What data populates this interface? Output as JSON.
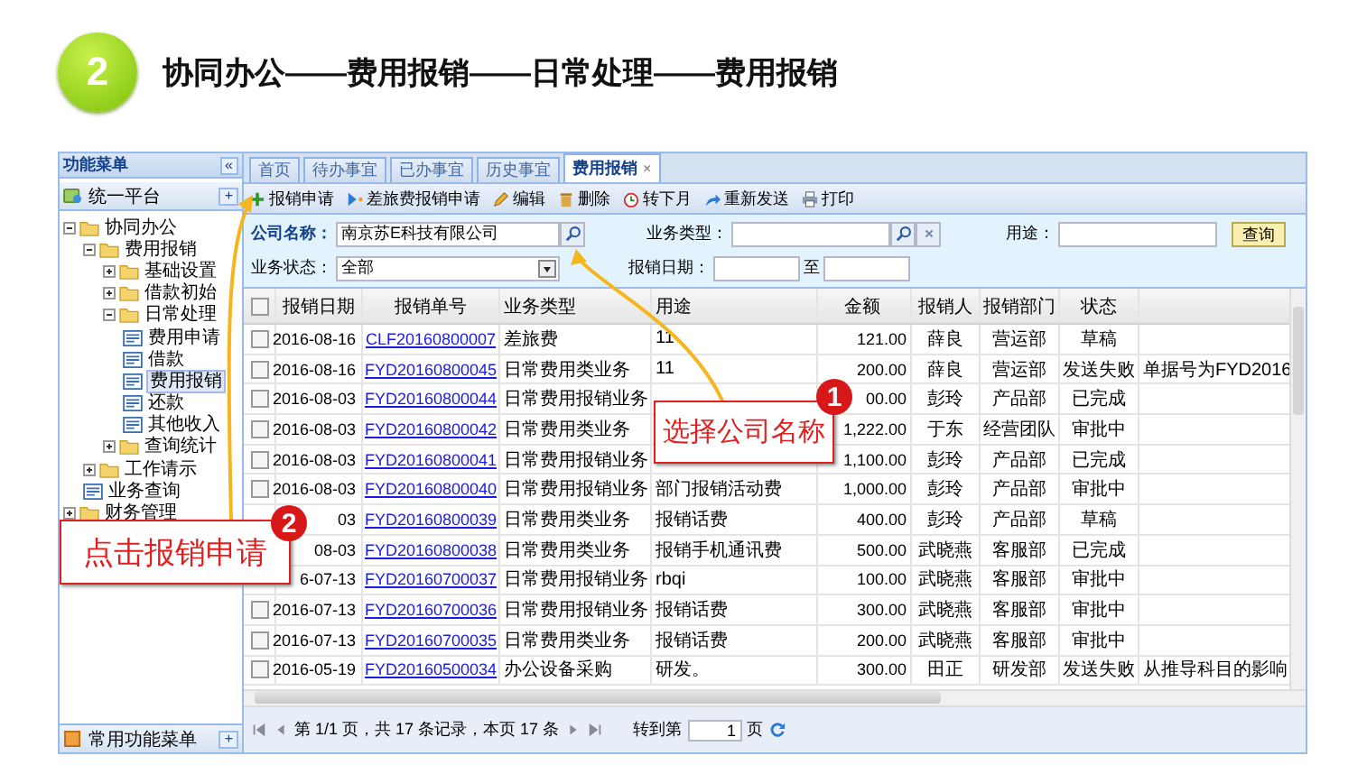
{
  "slide": {
    "step": "2",
    "title": "协同办公——费用报销——日常处理——费用报销"
  },
  "sidebar": {
    "title": "功能菜单",
    "collapse_button": "«",
    "platform": "统一平台",
    "platform_button": "+",
    "footer": "常用功能菜单",
    "footer_button": "+",
    "tree": [
      {
        "label": "协同办公",
        "kind": "folder",
        "expanded": true,
        "children": [
          {
            "label": "费用报销",
            "kind": "folder",
            "expanded": true,
            "children": [
              {
                "label": "基础设置",
                "kind": "folder",
                "expanded": false
              },
              {
                "label": "借款初始",
                "kind": "folder",
                "expanded": false
              },
              {
                "label": "日常处理",
                "kind": "folder",
                "expanded": true,
                "children": [
                  {
                    "label": "费用申请",
                    "kind": "page",
                    "selected": false
                  },
                  {
                    "label": "借款",
                    "kind": "page",
                    "selected": false
                  },
                  {
                    "label": "费用报销",
                    "kind": "page",
                    "selected": true
                  },
                  {
                    "label": "还款",
                    "kind": "page",
                    "selected": false
                  },
                  {
                    "label": "其他收入",
                    "kind": "page",
                    "selected": false
                  }
                ]
              },
              {
                "label": "查询统计",
                "kind": "folder",
                "expanded": false
              }
            ]
          },
          {
            "label": "工作请示",
            "kind": "folder",
            "expanded": false
          },
          {
            "label": "业务查询",
            "kind": "page",
            "selected": false
          }
        ]
      },
      {
        "label": "财务管理",
        "kind": "folder",
        "expanded": false
      }
    ]
  },
  "tabs": [
    {
      "label": "首页",
      "selected": false
    },
    {
      "label": "待办事宜",
      "selected": false
    },
    {
      "label": "已办事宜",
      "selected": false
    },
    {
      "label": "历史事宜",
      "selected": false
    },
    {
      "label": "费用报销",
      "selected": true,
      "close": "×"
    }
  ],
  "toolbar": [
    {
      "label": "报销申请",
      "kind": "add"
    },
    {
      "label": "差旅费报销申请",
      "kind": "travel"
    },
    {
      "label": "编辑",
      "kind": "edit"
    },
    {
      "label": "删除",
      "kind": "delete"
    },
    {
      "label": "转下月",
      "kind": "transfer"
    },
    {
      "label": "重新发送",
      "kind": "resend"
    },
    {
      "label": "打印",
      "kind": "print"
    }
  ],
  "filters": {
    "company": {
      "label": "公司名称：",
      "value": "南京苏E科技有限公司"
    },
    "business_type": {
      "label": "业务类型："
    },
    "purpose": {
      "label": "用途："
    },
    "query_button": "查询",
    "status": {
      "label": "业务状态：",
      "value": "全部"
    },
    "date": {
      "label": "报销日期：",
      "separator": "至"
    }
  },
  "table": {
    "header_checked": false,
    "columns": [
      "报销日期",
      "报销单号",
      "业务类型",
      "用途",
      "金额",
      "报销人",
      "报销部门",
      "状态"
    ],
    "rows": [
      {
        "checked": false,
        "date": "2016-08-16",
        "number": "CLF20160800007",
        "type": "差旅费",
        "purpose": "11",
        "amount": "121.00",
        "person": "薛良",
        "dept": "营运部",
        "status": "草稿"
      },
      {
        "checked": false,
        "date": "2016-08-16",
        "number": "FYD20160800045",
        "type": "日常费用类业务",
        "purpose": "11",
        "amount": "200.00",
        "person": "薛良",
        "dept": "营运部",
        "status": "发送失败",
        "column_9": "单据号为FYD2016"
      },
      {
        "checked": false,
        "date": "2016-08-03",
        "number": "FYD20160800044",
        "type": "日常费用报销业务",
        "amount": "00.00",
        "person": "彭玲",
        "dept": "产品部",
        "status": "已完成"
      },
      {
        "checked": false,
        "date": "2016-08-03",
        "number": "FYD20160800042",
        "type": "日常费用类业务",
        "amount": "1,222.00",
        "person": "于东",
        "dept": "经营团队",
        "status": "审批中"
      },
      {
        "checked": false,
        "date": "2016-08-03",
        "number": "FYD20160800041",
        "type": "日常费用报销业务",
        "amount": "1,100.00",
        "person": "彭玲",
        "dept": "产品部",
        "status": "已完成"
      },
      {
        "checked": false,
        "date": "2016-08-03",
        "number": "FYD20160800040",
        "type": "日常费用报销业务",
        "purpose": "部门报销活动费",
        "amount": "1,000.00",
        "person": "彭玲",
        "dept": "产品部",
        "status": "审批中"
      },
      {
        "date": "03",
        "number": "FYD20160800039",
        "type": "日常费用类业务",
        "purpose": "报销话费",
        "amount": "400.00",
        "person": "彭玲",
        "dept": "产品部",
        "status": "草稿"
      },
      {
        "date": "08-03",
        "number": "FYD20160800038",
        "type": "日常费用类业务",
        "purpose": "报销手机通讯费",
        "amount": "500.00",
        "person": "武晓燕",
        "dept": "客服部",
        "status": "已完成"
      },
      {
        "date": "6-07-13",
        "number": "FYD20160700037",
        "type": "日常费用报销业务",
        "purpose": "rbqi",
        "amount": "100.00",
        "person": "武晓燕",
        "dept": "客服部",
        "status": "审批中"
      },
      {
        "checked": false,
        "date": "2016-07-13",
        "number": "FYD20160700036",
        "type": "日常费用报销业务",
        "purpose": "报销话费",
        "amount": "300.00",
        "person": "武晓燕",
        "dept": "客服部",
        "status": "审批中"
      },
      {
        "checked": false,
        "date": "2016-07-13",
        "number": "FYD20160700035",
        "type": "日常费用类业务",
        "purpose": "报销话费",
        "amount": "200.00",
        "person": "武晓燕",
        "dept": "客服部",
        "status": "审批中"
      },
      {
        "checked": false,
        "date": "2016-05-19",
        "number": "FYD20160500034",
        "type": "办公设备采购",
        "purpose": "研发。",
        "amount": "300.00",
        "person": "田正",
        "dept": "研发部",
        "status": "发送失败",
        "column_9": "从推导科目的影响"
      }
    ]
  },
  "pager": {
    "info": "第 1/1 页，共 17 条记录，本页 17 条",
    "goto_label": "转到第",
    "page_value": "1",
    "page_unit": "页"
  },
  "callouts": [
    {
      "number": "1",
      "text": "选择公司名称"
    },
    {
      "number": "2",
      "text": "点击报销申请"
    }
  ]
}
